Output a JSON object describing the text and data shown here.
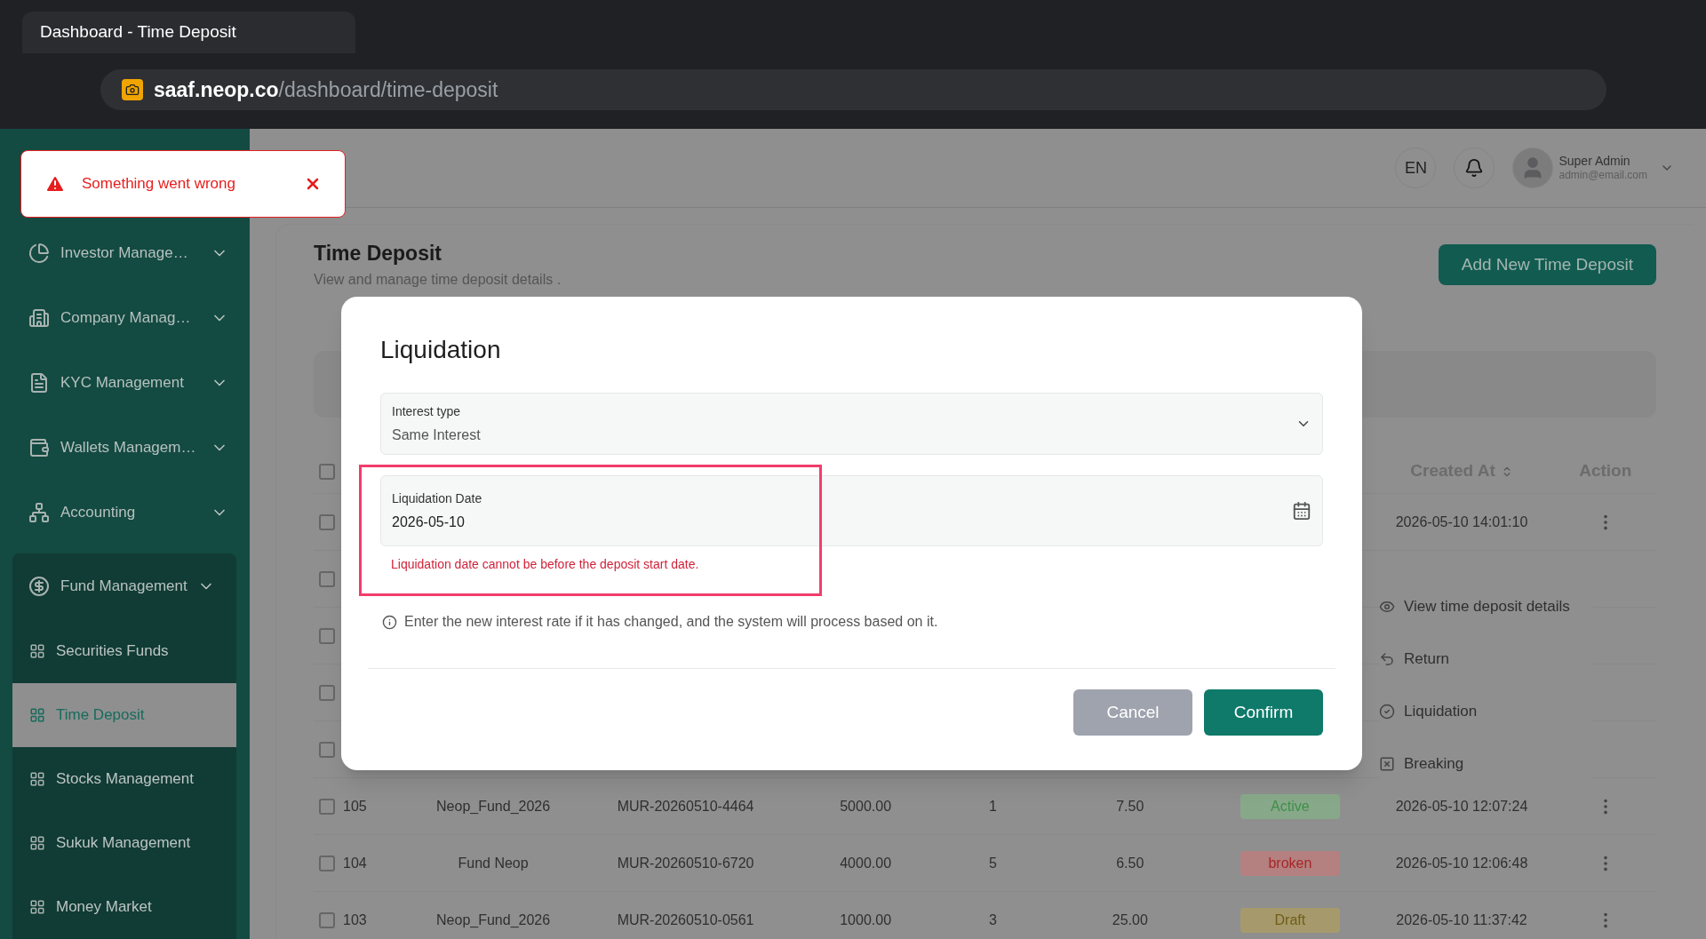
{
  "browser": {
    "tab_title": "Dashboard - Time Deposit",
    "url_host": "saaf.neop.co",
    "url_path": "/dashboard/time-deposit"
  },
  "toast": {
    "message": "Something went wrong"
  },
  "sidebar": {
    "items": [
      {
        "label": "Investor Manage…",
        "expanded": false
      },
      {
        "label": "Company Manag…",
        "expanded": false
      },
      {
        "label": "KYC Management",
        "expanded": false
      },
      {
        "label": "Wallets Managem…",
        "expanded": false
      },
      {
        "label": "Accounting",
        "expanded": false
      },
      {
        "label": "Fund Management",
        "expanded": true,
        "children": [
          {
            "label": "Securities Funds",
            "selected": false
          },
          {
            "label": "Time Deposit",
            "selected": true
          },
          {
            "label": "Stocks Management",
            "selected": false
          },
          {
            "label": "Sukuk Management",
            "selected": false
          },
          {
            "label": "Money Market",
            "selected": false
          }
        ]
      }
    ]
  },
  "header": {
    "language": "EN",
    "user": {
      "name": "Super Admin",
      "email": "admin@email.com"
    }
  },
  "page": {
    "title": "Time Deposit",
    "subtitle": "View and manage time deposit details .",
    "add_button": "Add New Time Deposit"
  },
  "table": {
    "select_all_checked": false,
    "columns": [
      {
        "label": "Created At",
        "sortable": true
      },
      {
        "label": "Action",
        "sortable": false
      }
    ],
    "rows": [
      {
        "checked": false,
        "created_at": "2026-05-10 14:01:10"
      },
      {
        "checked": false
      },
      {
        "checked": false
      },
      {
        "checked": false
      },
      {
        "checked": false
      },
      {
        "checked": false,
        "column_1": "105",
        "column_2": "Neop_Fund_2026",
        "column_3": "MUR-20260510-4464",
        "column_4": "5000.00",
        "column_5": "1",
        "column_6": "7.50",
        "status": {
          "label": "Active",
          "kind": "active"
        },
        "created_at": "2026-05-10 12:07:24"
      },
      {
        "checked": false,
        "column_1": "104",
        "column_2": "Fund Neop",
        "column_3": "MUR-20260510-6720",
        "column_4": "4000.00",
        "column_5": "5",
        "column_6": "6.50",
        "status": {
          "label": "broken",
          "kind": "broken"
        },
        "created_at": "2026-05-10 12:06:48"
      },
      {
        "checked": false,
        "column_1": "103",
        "column_2": "Neop_Fund_2026",
        "column_3": "MUR-20260510-0561",
        "column_4": "1000.00",
        "column_5": "3",
        "column_6": "25.00",
        "status": {
          "label": "Draft",
          "kind": "draft"
        },
        "created_at": "2026-05-10 11:37:42"
      }
    ]
  },
  "row_menu": {
    "items": [
      {
        "label": "View time deposit details",
        "kind": "view"
      },
      {
        "label": "Return",
        "kind": "return"
      },
      {
        "label": "Liquidation",
        "kind": "liquidation"
      },
      {
        "label": "Breaking",
        "kind": "breaking"
      }
    ]
  },
  "dialog": {
    "title": "Liquidation",
    "fields": [
      {
        "kind": "select",
        "label": "Interest type",
        "value": "Same Interest"
      },
      {
        "kind": "date",
        "label": "Liquidation Date",
        "value": "2026-05-10",
        "error": "Liquidation date cannot be before the deposit start date.",
        "highlighted": true
      }
    ],
    "note": "Enter the new interest rate if it has changed, and the system will process based on it.",
    "buttons": [
      {
        "label": "Cancel",
        "kind": "secondary"
      },
      {
        "label": "Confirm",
        "kind": "primary"
      }
    ]
  }
}
